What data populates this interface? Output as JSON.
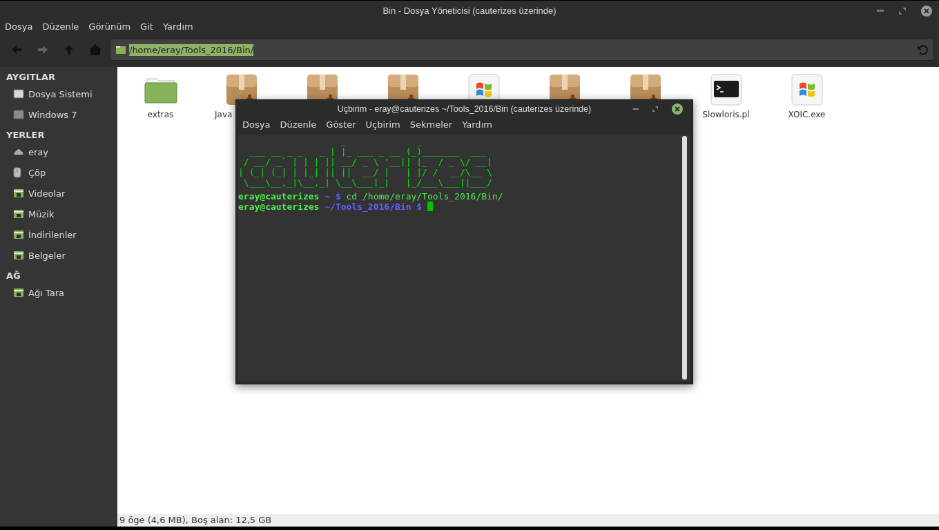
{
  "window": {
    "title": "Bin - Dosya Yöneticisi (cauterizes üzerinde)"
  },
  "menu": [
    "Dosya",
    "Düzenle",
    "Görünüm",
    "Git",
    "Yardım"
  ],
  "toolbar": {
    "buttons": [
      {
        "kind": "back",
        "disabled": false
      },
      {
        "kind": "forward",
        "disabled": true
      },
      {
        "kind": "up",
        "disabled": false
      },
      {
        "kind": "home",
        "disabled": false
      }
    ],
    "location": {
      "value": "/home/eray/Tools_2016/Bin/",
      "selected": true
    }
  },
  "sidebar": [
    {
      "heading": "AYGITLAR",
      "items": [
        {
          "label": "Dosya Sistemi",
          "kind": "drive"
        },
        {
          "label": "Windows 7",
          "kind": "drive-dark"
        }
      ]
    },
    {
      "heading": "YERLER",
      "items": [
        {
          "label": "eray",
          "kind": "home"
        },
        {
          "label": "Çöp",
          "kind": "trash"
        },
        {
          "label": "Videolar",
          "kind": "folder"
        },
        {
          "label": "Müzik",
          "kind": "folder"
        },
        {
          "label": "İndirilenler",
          "kind": "folder"
        },
        {
          "label": "Belgeler",
          "kind": "folder"
        }
      ]
    },
    {
      "heading": "AĞ",
      "items": [
        {
          "label": "Ağı Tara",
          "kind": "folder"
        }
      ]
    }
  ],
  "files": [
    {
      "label": "extras",
      "kind": "folder"
    },
    {
      "label": "Java",
      "kind": "package",
      "label_clipped": true
    },
    {
      "kind": "package"
    },
    {
      "kind": "package"
    },
    {
      "kind": "windows"
    },
    {
      "kind": "package"
    },
    {
      "kind": "package"
    },
    {
      "label": "Slowloris.pl",
      "kind": "terminal"
    },
    {
      "label": "XOIC.exe",
      "kind": "windows"
    }
  ],
  "terminal": {
    "title": "Uçbirim - eray@cauterizes ~/Tools_2016/Bin (cauterizes üzerinde)",
    "menu": [
      "Dosya",
      "Düzenle",
      "Göster",
      "Uçbirim",
      "Sekmeler",
      "Yardım"
    ],
    "banner": "                   _             _\n  ___ __ _ _   _ | |_ ___ _ __ (_)_______  ___\n / __/ _` | | | || __/ _ \\ '__|| |_  / _ \\/ __|\n| (_| (_| | |_| || ||  __/ |   | |/ /  __/\\__ \\\n \\___\\__,_|\\__,_| \\__\\___|_|   |_/___\\___||___/",
    "lines": [
      {
        "user": "eray@cauterizes",
        "path": "~",
        "symbol": "$",
        "command": "cd /home/eray/Tools_2016/Bin/",
        "cursor": false
      },
      {
        "user": "eray@cauterizes",
        "path": "~/Tools_2016/Bin",
        "symbol": "$",
        "cursor": true
      }
    ]
  },
  "status_bar": "9 öge (4,6 MB), Boş alan: 12,5 GB"
}
